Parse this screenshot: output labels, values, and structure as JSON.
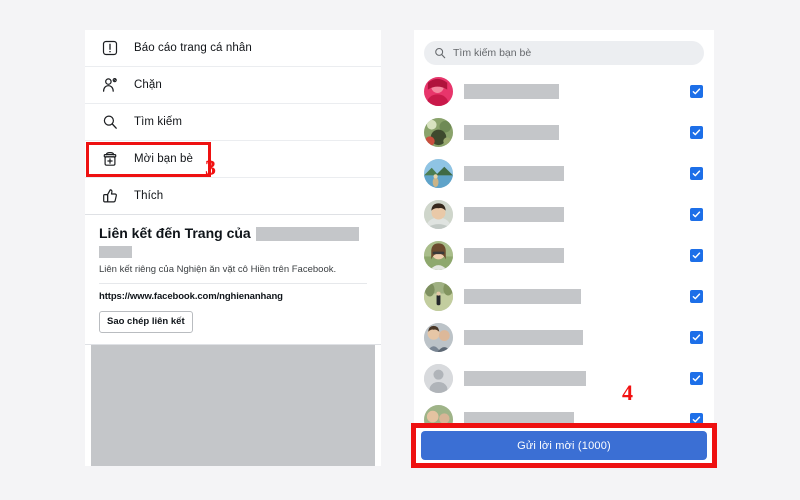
{
  "background_color": "#f4f4f6",
  "accent_blue": "#1d6fe8",
  "annotation_red": "#ee1111",
  "left_panel": {
    "menu": [
      {
        "icon": "report-icon",
        "label": "Báo cáo trang cá nhân"
      },
      {
        "icon": "block-user-icon",
        "label": "Chặn"
      },
      {
        "icon": "search-icon",
        "label": "Tìm kiếm"
      },
      {
        "icon": "invite-friend-icon",
        "label": "Mời bạn bè",
        "highlighted": true
      },
      {
        "icon": "thumbs-up-icon",
        "label": "Thích"
      }
    ],
    "link_section": {
      "title": "Liên kết đến Trang của",
      "description": "Liên kết riêng của Nghiện ăn vặt cô Hiền trên Facebook.",
      "url": "https://www.facebook.com/nghienanhang",
      "copy_button": "Sao chép liên kết"
    }
  },
  "annotations": {
    "step_three": "3",
    "step_four": "4"
  },
  "right_panel": {
    "search": {
      "placeholder": "Tìm kiếm bạn bè",
      "value": ""
    },
    "friends": [
      {
        "avatar": "avatar-woman-red",
        "name_width": 95,
        "checked": true
      },
      {
        "avatar": "avatar-flowers",
        "name_width": 95,
        "checked": true
      },
      {
        "avatar": "avatar-lake-scene",
        "name_width": 100,
        "checked": true
      },
      {
        "avatar": "avatar-young-man",
        "name_width": 100,
        "checked": true
      },
      {
        "avatar": "avatar-woman-glasses",
        "name_width": 100,
        "checked": true
      },
      {
        "avatar": "avatar-field-person",
        "name_width": 117,
        "checked": true
      },
      {
        "avatar": "avatar-couple",
        "name_width": 119,
        "checked": true
      },
      {
        "avatar": "avatar-default-person",
        "name_width": 122,
        "checked": true
      },
      {
        "avatar": "avatar-group",
        "name_width": 110,
        "checked": true
      }
    ],
    "cta_button": "Gửi lời mời (1000)"
  }
}
